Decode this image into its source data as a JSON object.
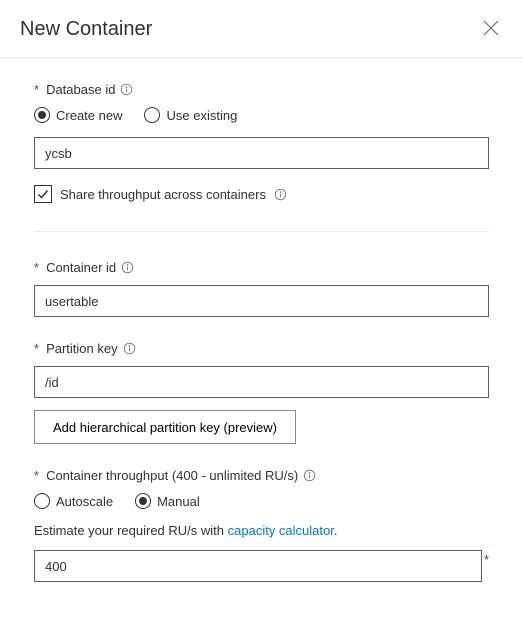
{
  "header": {
    "title": "New Container"
  },
  "database": {
    "label": "Database id",
    "radio": {
      "create_new": "Create new",
      "use_existing": "Use existing",
      "selected": "create_new"
    },
    "value": "ycsb",
    "share_label": "Share throughput across containers",
    "share_checked": true
  },
  "container": {
    "id_label": "Container id",
    "id_value": "usertable",
    "pk_label": "Partition key",
    "pk_value": "/id",
    "hier_btn": "Add hierarchical partition key (preview)"
  },
  "throughput": {
    "label": "Container throughput (400 - unlimited RU/s)",
    "radio": {
      "autoscale": "Autoscale",
      "manual": "Manual",
      "selected": "manual"
    },
    "desc_prefix": "Estimate your required RU/s with ",
    "desc_link": "capacity calculator",
    "desc_suffix": ".",
    "value": "400"
  }
}
